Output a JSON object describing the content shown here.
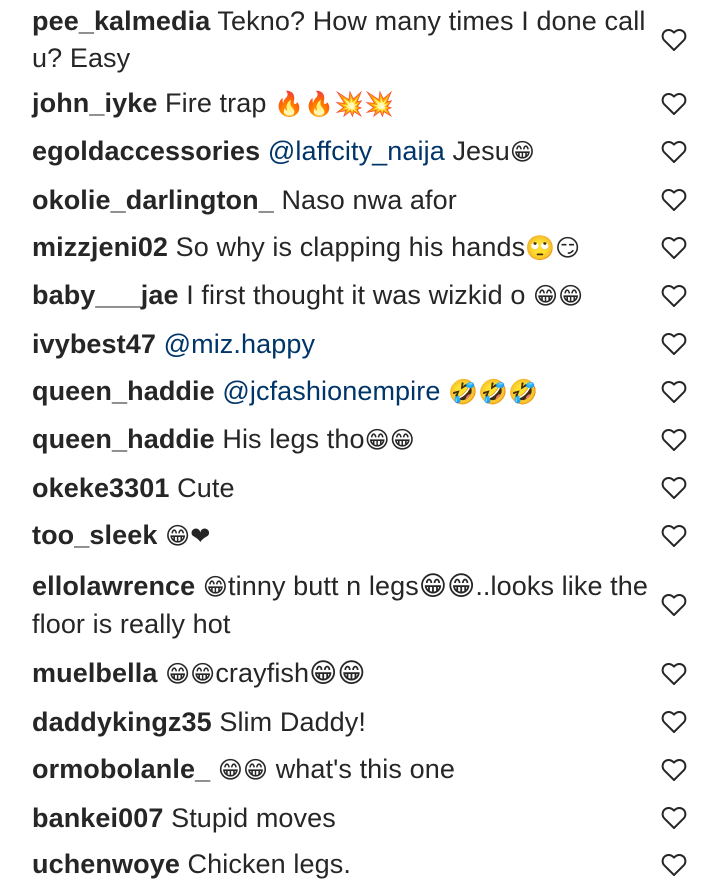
{
  "comments": [
    {
      "user": "pee_kalmedia",
      "pre": "",
      "text": " Tekno? How many times I done call u? Easy",
      "mention": "",
      "post": "",
      "emoji": "",
      "after": ""
    },
    {
      "user": "john_iyke",
      "pre": "",
      "text": " Fire trap ",
      "mention": "",
      "post": "",
      "emoji": "🔥🔥💥💥",
      "after": ""
    },
    {
      "user": "egoldaccessories",
      "pre": " ",
      "text": "",
      "mention": "@laffcity_naija",
      "post": " Jesu",
      "emoji": "😁",
      "after": ""
    },
    {
      "user": "okolie_darlington_",
      "pre": "",
      "text": " Naso nwa afor",
      "mention": "",
      "post": "",
      "emoji": "",
      "after": ""
    },
    {
      "user": "mizzjeni02",
      "pre": "",
      "text": " So why is clapping his hands",
      "mention": "",
      "post": "",
      "emoji": "🙄😏",
      "after": ""
    },
    {
      "user": "baby___jae",
      "pre": "",
      "text": " I first thought it was wizkid o ",
      "mention": "",
      "post": "",
      "emoji": "😁😁",
      "after": ""
    },
    {
      "user": "ivybest47",
      "pre": " ",
      "text": "",
      "mention": "@miz.happy",
      "post": "",
      "emoji": "",
      "after": ""
    },
    {
      "user": "queen_haddie",
      "pre": " ",
      "text": "",
      "mention": "@jcfashionempire",
      "post": " ",
      "emoji": "🤣🤣🤣",
      "after": ""
    },
    {
      "user": "queen_haddie",
      "pre": "",
      "text": " His legs tho",
      "mention": "",
      "post": "",
      "emoji": "😁😁",
      "after": ""
    },
    {
      "user": "okeke3301",
      "pre": "",
      "text": " Cute",
      "mention": "",
      "post": "",
      "emoji": "",
      "after": ""
    },
    {
      "user": "too_sleek",
      "pre": "",
      "text": " ",
      "mention": "",
      "post": "",
      "emoji": "😁❤",
      "after": ""
    },
    {
      "user": "ellolawrence",
      "pre": "",
      "text": " ",
      "mention": "",
      "post": "",
      "emoji": "😁",
      "after": "tinny butt n legs😁😁..looks like the floor is really hot"
    },
    {
      "user": "muelbella",
      "pre": "",
      "text": " ",
      "mention": "",
      "post": "",
      "emoji": "😁😁",
      "after": "crayfish😁😁"
    },
    {
      "user": "daddykingz35",
      "pre": "",
      "text": " Slim Daddy!",
      "mention": "",
      "post": "",
      "emoji": "",
      "after": ""
    },
    {
      "user": "ormobolanle_",
      "pre": "",
      "text": " ",
      "mention": "",
      "post": "",
      "emoji": "😁😁",
      "after": " what's this one"
    },
    {
      "user": "bankei007",
      "pre": "",
      "text": " Stupid moves",
      "mention": "",
      "post": "",
      "emoji": "",
      "after": ""
    },
    {
      "user": "uchenwoye",
      "pre": "",
      "text": " Chicken legs.",
      "mention": "",
      "post": "",
      "emoji": "",
      "after": ""
    }
  ],
  "icons": {
    "like": "heart-outline-icon"
  },
  "colors": {
    "text": "#262626",
    "mention": "#003569",
    "icon": "#262626"
  }
}
